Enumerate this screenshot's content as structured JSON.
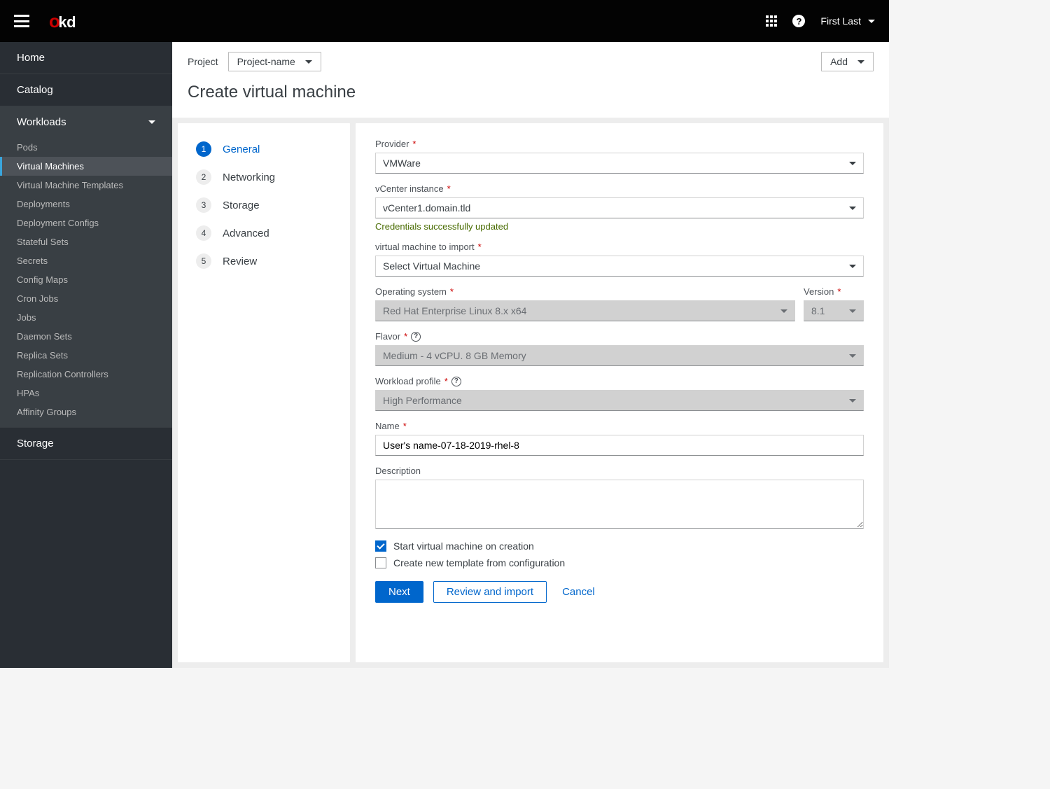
{
  "topbar": {
    "logo_o": "o",
    "logo_kd": "kd",
    "user": "First Last"
  },
  "sidebar": {
    "home": "Home",
    "catalog": "Catalog",
    "workloads": "Workloads",
    "storage": "Storage",
    "sub": {
      "pods": "Pods",
      "vms": "Virtual Machines",
      "vmts": "Virtual Machine Templates",
      "deployments": "Deployments",
      "depconfigs": "Deployment Configs",
      "stateful": "Stateful Sets",
      "secrets": "Secrets",
      "configmaps": "Config Maps",
      "cronjobs": "Cron Jobs",
      "jobs": "Jobs",
      "daemon": "Daemon Sets",
      "replica": "Replica Sets",
      "rc": "Replication Controllers",
      "hpas": "HPAs",
      "affinity": "Affinity Groups"
    }
  },
  "header": {
    "project_label": "Project",
    "project_name": "Project-name",
    "add": "Add",
    "title": "Create virtual machine"
  },
  "wizard": {
    "s1": "General",
    "s2": "Networking",
    "s3": "Storage",
    "s4": "Advanced",
    "s5": "Review"
  },
  "form": {
    "provider_label": "Provider",
    "provider_value": "VMWare",
    "vcenter_label": "vCenter instance",
    "vcenter_value": "vCenter1.domain.tld",
    "vcenter_success": "Credentials successfully updated",
    "vm_import_label": "virtual machine to import",
    "vm_import_value": "Select Virtual Machine",
    "os_label": "Operating system",
    "os_value": "Red Hat Enterprise Linux 8.x x64",
    "version_label": "Version",
    "version_value": "8.1",
    "flavor_label": "Flavor",
    "flavor_value": "Medium - 4 vCPU. 8 GB Memory",
    "workload_label": "Workload profile",
    "workload_value": "High Performance",
    "name_label": "Name",
    "name_value": "User's name-07-18-2019-rhel-8",
    "desc_label": "Description",
    "desc_value": "",
    "cb_start": "Start virtual machine on creation",
    "cb_template": "Create new template from configuration"
  },
  "actions": {
    "next": "Next",
    "review": "Review and import",
    "cancel": "Cancel"
  }
}
